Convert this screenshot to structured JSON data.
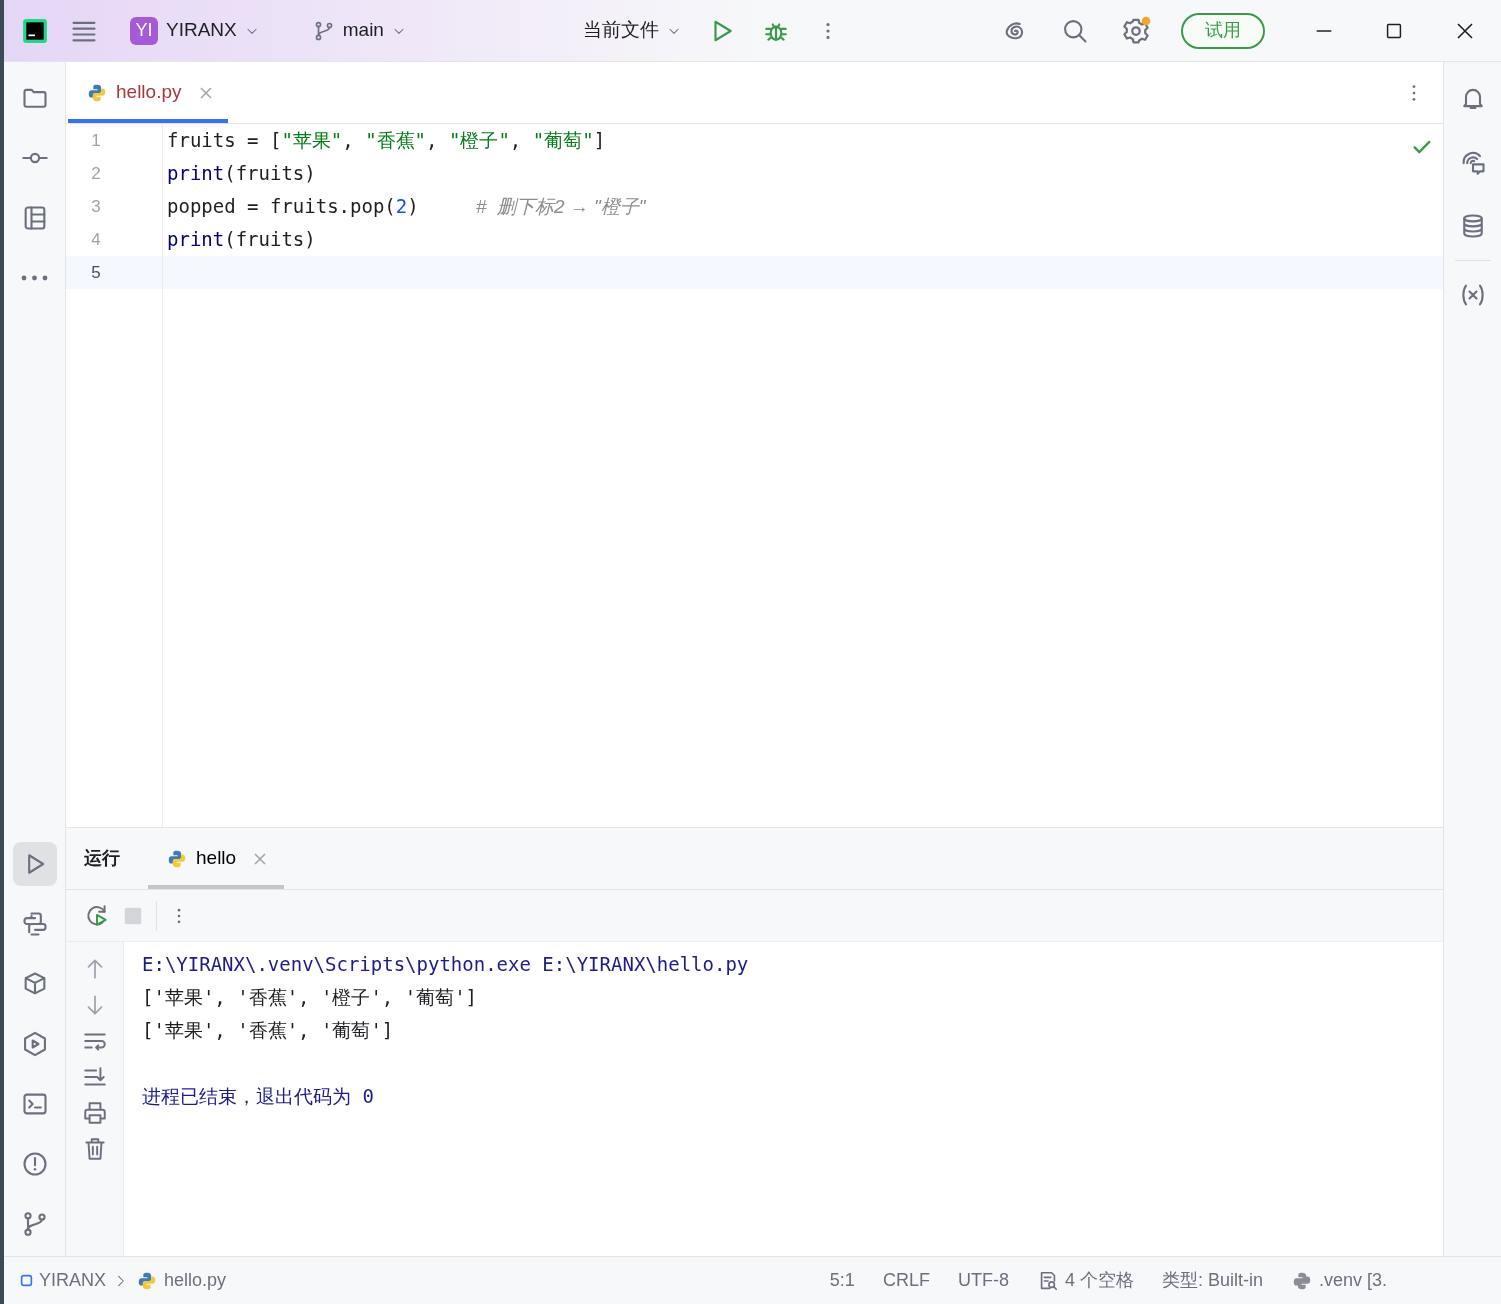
{
  "title_bar": {
    "project_badge": "YI",
    "project": "YIRANX",
    "branch": "main",
    "run_config": "当前文件",
    "trial_button": "试用",
    "settings_notification": true
  },
  "left_toolbar": {
    "top": [
      {
        "kind": "folder",
        "selected": false
      },
      {
        "kind": "commit",
        "selected": false
      },
      {
        "kind": "structure",
        "selected": false
      },
      {
        "kind": "more",
        "selected": false
      }
    ],
    "bottom": [
      {
        "kind": "run",
        "selected": true
      },
      {
        "kind": "python",
        "selected": false
      },
      {
        "kind": "packages",
        "selected": false
      },
      {
        "kind": "services",
        "selected": false
      },
      {
        "kind": "terminal",
        "selected": false
      },
      {
        "kind": "problems",
        "selected": false
      },
      {
        "kind": "git",
        "selected": false
      }
    ]
  },
  "editor": {
    "tabs": [
      {
        "label": "hello.py",
        "selected": true
      }
    ],
    "inspection_ok": true,
    "lines": [
      {
        "number": "1",
        "current": false,
        "tokens": [
          {
            "kind": "plain",
            "text": "fruits = ["
          },
          {
            "kind": "string",
            "text": "\"苹果\""
          },
          {
            "kind": "plain",
            "text": ", "
          },
          {
            "kind": "string",
            "text": "\"香蕉\""
          },
          {
            "kind": "plain",
            "text": ", "
          },
          {
            "kind": "string",
            "text": "\"橙子\""
          },
          {
            "kind": "plain",
            "text": ", "
          },
          {
            "kind": "string",
            "text": "\"葡萄\""
          },
          {
            "kind": "plain",
            "text": "]"
          }
        ]
      },
      {
        "number": "2",
        "current": false,
        "tokens": [
          {
            "kind": "builtin",
            "text": "print"
          },
          {
            "kind": "plain",
            "text": "(fruits)"
          }
        ]
      },
      {
        "number": "3",
        "current": false,
        "tokens": [
          {
            "kind": "plain",
            "text": "popped = fruits.pop("
          },
          {
            "kind": "number",
            "text": "2"
          },
          {
            "kind": "plain",
            "text": ")     "
          },
          {
            "kind": "comment",
            "text": "#  删下标2 → \"橙子\""
          }
        ]
      },
      {
        "number": "4",
        "current": false,
        "tokens": [
          {
            "kind": "builtin",
            "text": "print"
          },
          {
            "kind": "plain",
            "text": "(fruits)"
          }
        ]
      },
      {
        "number": "5",
        "current": true
      }
    ]
  },
  "right_toolbar": [
    {
      "kind": "bell"
    },
    {
      "kind": "assistant"
    },
    {
      "kind": "database"
    },
    {
      "kind": "variables"
    }
  ],
  "run_panel": {
    "title": "运行",
    "tabs": [
      {
        "label": "hello",
        "selected": true
      }
    ],
    "output": [
      {
        "kind": "command",
        "text": "E:\\YIRANX\\.venv\\Scripts\\python.exe E:\\YIRANX\\hello.py"
      },
      {
        "kind": "stdout",
        "text": "['苹果', '香蕉', '橙子', '葡萄']"
      },
      {
        "kind": "stdout",
        "text": "['苹果', '香蕉', '葡萄']"
      },
      {
        "kind": "exit",
        "text": "进程已结束，退出代码为 0"
      }
    ]
  },
  "status_bar": {
    "path": [
      "YIRANX",
      "hello.py"
    ],
    "position": "5:1",
    "line_ending": "CRLF",
    "encoding": "UTF-8",
    "indent": "4 个空格",
    "file_type": "类型: Built-in",
    "interpreter": ".venv [3."
  }
}
